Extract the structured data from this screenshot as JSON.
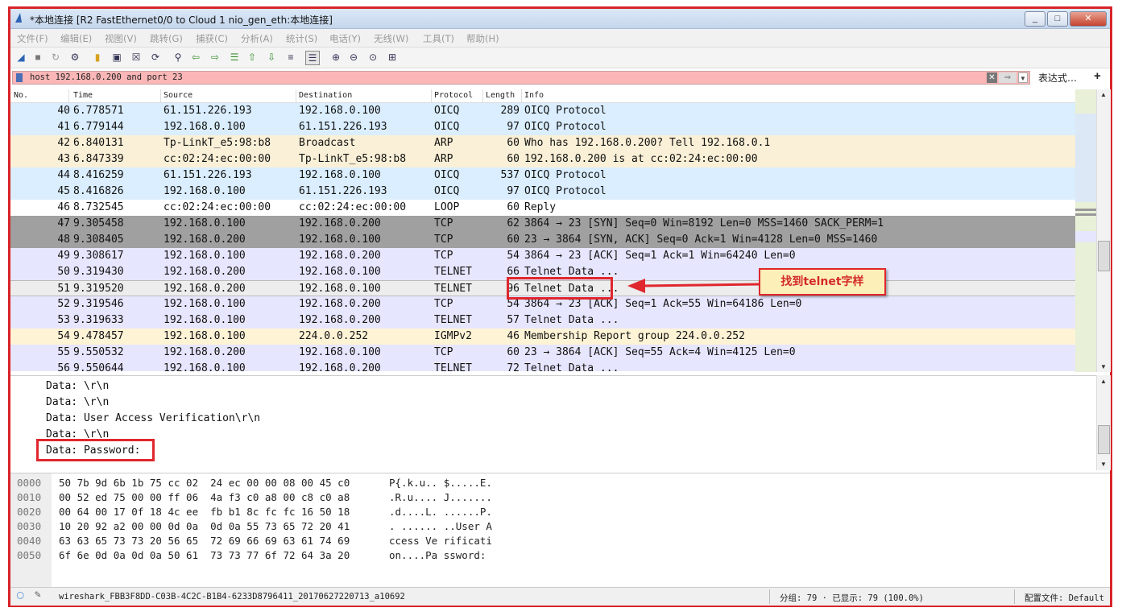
{
  "window": {
    "title": "*本地连接 [R2 FastEthernet0/0 to Cloud 1 nio_gen_eth:本地连接]",
    "controls": [
      "minimize",
      "maximize",
      "close"
    ]
  },
  "menu": [
    "文件(F)",
    "编辑(E)",
    "视图(V)",
    "跳转(G)",
    "捕获(C)",
    "分析(A)",
    "统计(S)",
    "电话(Y)",
    "无线(W)",
    "工具(T)",
    "帮助(H)"
  ],
  "toolbar": [
    "shark-fin-start-icon",
    "stop-icon",
    "restart-icon",
    "options-icon",
    "open-icon",
    "save-icon",
    "close-file-icon",
    "reload-icon",
    "find-icon",
    "back-icon",
    "forward-icon",
    "goto-icon",
    "first-icon",
    "last-icon",
    "autoscroll-icon",
    "colorize-icon",
    "zoom-in-icon",
    "zoom-out-icon",
    "zoom-reset-icon",
    "resize-columns-icon"
  ],
  "filter": {
    "value": "host 192.168.0.200 and port 23",
    "expression_label": "表达式…",
    "add_label": "+"
  },
  "packet_list": {
    "columns": [
      "No.",
      "Time",
      "Source",
      "Destination",
      "Protocol",
      "Length",
      "Info"
    ],
    "rows": [
      {
        "no": "40",
        "time": "6.778571",
        "src": "61.151.226.193",
        "dst": "192.168.0.100",
        "proto": "OICQ",
        "len": "289",
        "info": "OICQ Protocol",
        "bg": "#daeeff"
      },
      {
        "no": "41",
        "time": "6.779144",
        "src": "192.168.0.100",
        "dst": "61.151.226.193",
        "proto": "OICQ",
        "len": "97",
        "info": "OICQ Protocol",
        "bg": "#daeeff"
      },
      {
        "no": "42",
        "time": "6.840131",
        "src": "Tp-LinkT_e5:98:b8",
        "dst": "Broadcast",
        "proto": "ARP",
        "len": "60",
        "info": "Who has 192.168.0.200? Tell 192.168.0.1",
        "bg": "#faf0d7"
      },
      {
        "no": "43",
        "time": "6.847339",
        "src": "cc:02:24:ec:00:00",
        "dst": "Tp-LinkT_e5:98:b8",
        "proto": "ARP",
        "len": "60",
        "info": "192.168.0.200 is at cc:02:24:ec:00:00",
        "bg": "#faf0d7"
      },
      {
        "no": "44",
        "time": "8.416259",
        "src": "61.151.226.193",
        "dst": "192.168.0.100",
        "proto": "OICQ",
        "len": "537",
        "info": "OICQ Protocol",
        "bg": "#daeeff"
      },
      {
        "no": "45",
        "time": "8.416826",
        "src": "192.168.0.100",
        "dst": "61.151.226.193",
        "proto": "OICQ",
        "len": "97",
        "info": "OICQ Protocol",
        "bg": "#daeeff"
      },
      {
        "no": "46",
        "time": "8.732545",
        "src": "cc:02:24:ec:00:00",
        "dst": "cc:02:24:ec:00:00",
        "proto": "LOOP",
        "len": "60",
        "info": "Reply",
        "bg": "#ffffff"
      },
      {
        "no": "47",
        "time": "9.305458",
        "src": "192.168.0.100",
        "dst": "192.168.0.200",
        "proto": "TCP",
        "len": "62",
        "info": "3864 → 23 [SYN] Seq=0 Win=8192 Len=0 MSS=1460 SACK_PERM=1",
        "bg": "#a0a0a0"
      },
      {
        "no": "48",
        "time": "9.308405",
        "src": "192.168.0.200",
        "dst": "192.168.0.100",
        "proto": "TCP",
        "len": "60",
        "info": "23 → 3864 [SYN, ACK] Seq=0 Ack=1 Win=4128 Len=0 MSS=1460",
        "bg": "#a0a0a0"
      },
      {
        "no": "49",
        "time": "9.308617",
        "src": "192.168.0.100",
        "dst": "192.168.0.200",
        "proto": "TCP",
        "len": "54",
        "info": "3864 → 23 [ACK] Seq=1 Ack=1 Win=64240 Len=0",
        "bg": "#e7e6ff"
      },
      {
        "no": "50",
        "time": "9.319430",
        "src": "192.168.0.200",
        "dst": "192.168.0.100",
        "proto": "TELNET",
        "len": "66",
        "info": "Telnet Data ...",
        "bg": "#e7e6ff"
      },
      {
        "no": "51",
        "time": "9.319520",
        "src": "192.168.0.200",
        "dst": "192.168.0.100",
        "proto": "TELNET",
        "len": "96",
        "info": "Telnet Data ...",
        "bg": "#ededed",
        "selected": true
      },
      {
        "no": "52",
        "time": "9.319546",
        "src": "192.168.0.100",
        "dst": "192.168.0.200",
        "proto": "TCP",
        "len": "54",
        "info": "3864 → 23 [ACK] Seq=1 Ack=55 Win=64186 Len=0",
        "bg": "#e7e6ff"
      },
      {
        "no": "53",
        "time": "9.319633",
        "src": "192.168.0.100",
        "dst": "192.168.0.200",
        "proto": "TELNET",
        "len": "57",
        "info": "Telnet Data ...",
        "bg": "#e7e6ff"
      },
      {
        "no": "54",
        "time": "9.478457",
        "src": "192.168.0.100",
        "dst": "224.0.0.252",
        "proto": "IGMPv2",
        "len": "46",
        "info": "Membership Report group 224.0.0.252",
        "bg": "#fff3d6"
      },
      {
        "no": "55",
        "time": "9.550532",
        "src": "192.168.0.200",
        "dst": "192.168.0.100",
        "proto": "TCP",
        "len": "60",
        "info": "23 → 3864 [ACK] Seq=55 Ack=4 Win=4125 Len=0",
        "bg": "#e7e6ff"
      },
      {
        "no": "56",
        "time": "9.550644",
        "src": "192.168.0.100",
        "dst": "192.168.0.200",
        "proto": "TELNET",
        "len": "72",
        "info": "Telnet Data ...",
        "bg": "#e7e6ff"
      }
    ]
  },
  "details": [
    "Data: \\r\\n",
    "Data: \\r\\n",
    "Data: User Access Verification\\r\\n",
    "Data: \\r\\n",
    "Data: Password:"
  ],
  "bytes": [
    {
      "off": "0000",
      "hex": "50 7b 9d 6b 1b 75 cc 02  24 ec 00 00 08 00 45 c0",
      "ascii": "P{.k.u.. $.....E."
    },
    {
      "off": "0010",
      "hex": "00 52 ed 75 00 00 ff 06  4a f3 c0 a8 00 c8 c0 a8",
      "ascii": ".R.u.... J......."
    },
    {
      "off": "0020",
      "hex": "00 64 00 17 0f 18 4c ee  fb b1 8c fc fc 16 50 18",
      "ascii": ".d....L. ......P."
    },
    {
      "off": "0030",
      "hex": "10 20 92 a2 00 00 0d 0a  0d 0a 55 73 65 72 20 41",
      "ascii": ". ...... ..User A"
    },
    {
      "off": "0040",
      "hex": "63 63 65 73 73 20 56 65  72 69 66 69 63 61 74 69",
      "ascii": "ccess Ve rificati"
    },
    {
      "off": "0050",
      "hex": "6f 6e 0d 0a 0d 0a 50 61  73 73 77 6f 72 64 3a 20",
      "ascii": "on....Pa ssword:"
    }
  ],
  "status": {
    "file": "wireshark_FBB3F8DD-C03B-4C2C-B1B4-6233D8796411_20170627220713_a10692",
    "packets": "分组: 79 · 已显示: 79 (100.0%)",
    "profile": "配置文件: Default"
  },
  "annotation": {
    "callout_text": "找到telnet字样"
  },
  "colors": {
    "highlight": "#e0272e",
    "filter_bg": "#fbb7b7",
    "callout_bg": "#fcf0b8"
  }
}
